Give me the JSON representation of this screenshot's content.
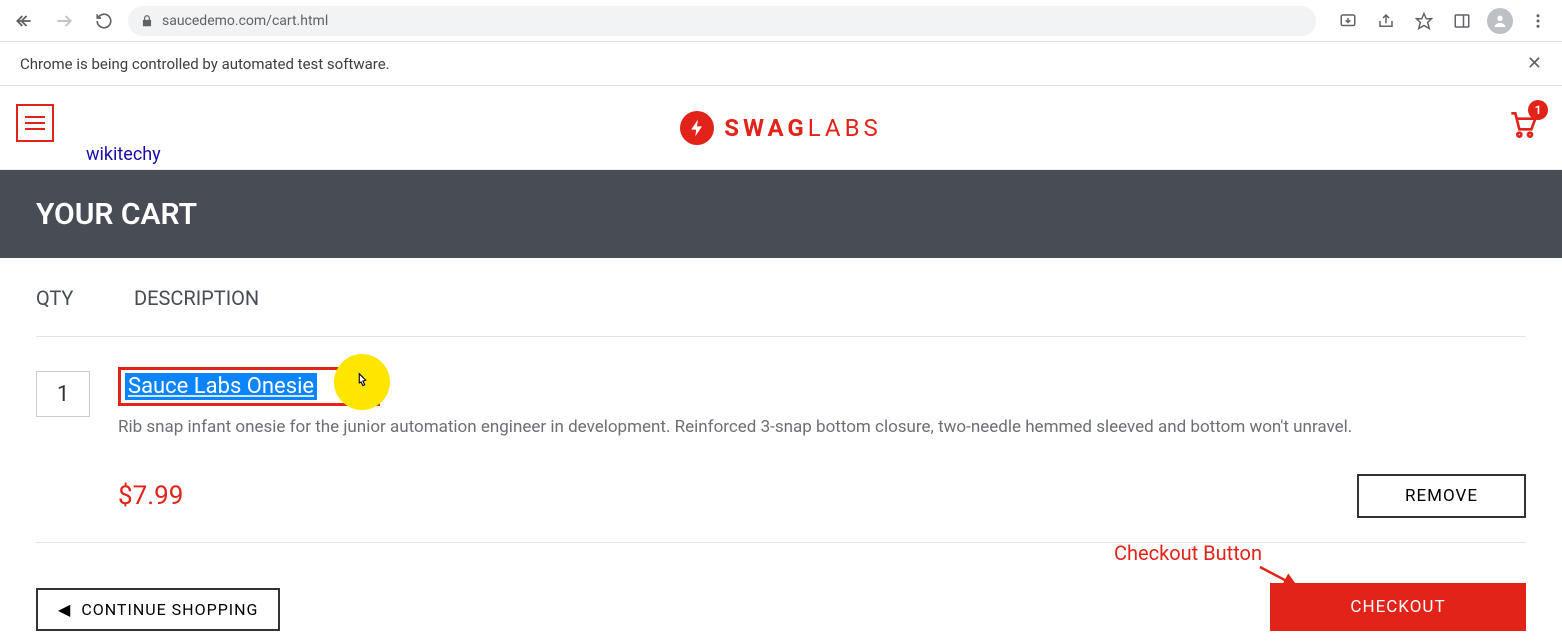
{
  "browser": {
    "url": "saucedemo.com/cart.html",
    "automation_banner": "Chrome is being controlled by automated test software."
  },
  "header": {
    "logo_bold": "SWAG",
    "logo_light": "LABS",
    "cart_count": "1",
    "wikitechy_label": "wikitechy"
  },
  "page": {
    "title": "YOUR CART",
    "qty_header": "QTY",
    "desc_header": "DESCRIPTION",
    "continue_label": "CONTINUE SHOPPING",
    "checkout_label": "CHECKOUT",
    "annotation_label": "Checkout Button"
  },
  "cart_items": [
    {
      "qty": "1",
      "name": "Sauce Labs Onesie",
      "description": "Rib snap infant onesie for the junior automation engineer in development. Reinforced 3-snap bottom closure, two-needle hemmed sleeved and bottom won't unravel.",
      "price": "$7.99",
      "remove_label": "REMOVE"
    }
  ]
}
